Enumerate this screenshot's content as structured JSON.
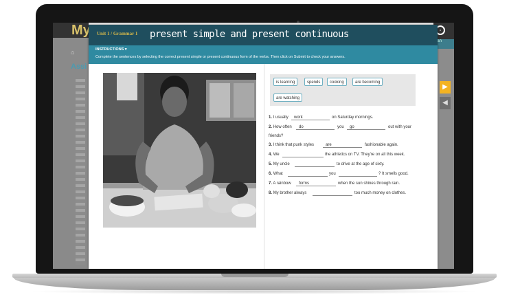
{
  "background": {
    "logo": "My",
    "home_label": "⌂",
    "partial_title": "Assi",
    "side_letters": "Se",
    "right_label": "Plan",
    "gear_partial": "o"
  },
  "header": {
    "breadcrumb": "Unit 1 / Grammar 1",
    "title": "present simple and present continuous"
  },
  "instructions": {
    "label": "INSTRUCTIONS",
    "text": "Complete the sentences by selecting the correct present simple or present continuous form of the verbs. Then click on Submit to check your answers."
  },
  "word_bank": [
    "is learning",
    "spends",
    "cooking",
    "are becoming",
    "are watching"
  ],
  "sentences": [
    {
      "num": "1.",
      "parts": [
        "I usually",
        "on Saturday mornings."
      ],
      "blanks": [
        "work"
      ]
    },
    {
      "num": "2.",
      "parts": [
        "How often",
        "you",
        "out with your"
      ],
      "blanks": [
        "do",
        "go"
      ],
      "line2": "friends?"
    },
    {
      "num": "3.",
      "parts": [
        "I think that punk styles",
        "fashionable again."
      ],
      "blanks": [
        "are"
      ]
    },
    {
      "num": "4.",
      "parts": [
        "We",
        "the athletics on TV. They're on all this week."
      ],
      "blanks": [
        ""
      ]
    },
    {
      "num": "5.",
      "parts": [
        "My uncle",
        "to drive at the age of sixty."
      ],
      "blanks": [
        ""
      ]
    },
    {
      "num": "6.",
      "parts": [
        "What",
        "you",
        "? It smells good."
      ],
      "blanks": [
        "",
        ""
      ]
    },
    {
      "num": "7.",
      "parts": [
        "A rainbow",
        "when the sun shines through rain."
      ],
      "blanks": [
        "forms"
      ]
    },
    {
      "num": "8.",
      "parts": [
        "My brother always",
        "too much money on clothes."
      ],
      "blanks": [
        ""
      ]
    }
  ],
  "nav": {
    "next_arrow": "▶",
    "prev_arrow": "◀"
  },
  "colors": {
    "header": "#1f4e5e",
    "instructions_bar": "#2f8aa1",
    "accent_yellow": "#f4b321",
    "breadcrumb": "#d4b74a"
  }
}
